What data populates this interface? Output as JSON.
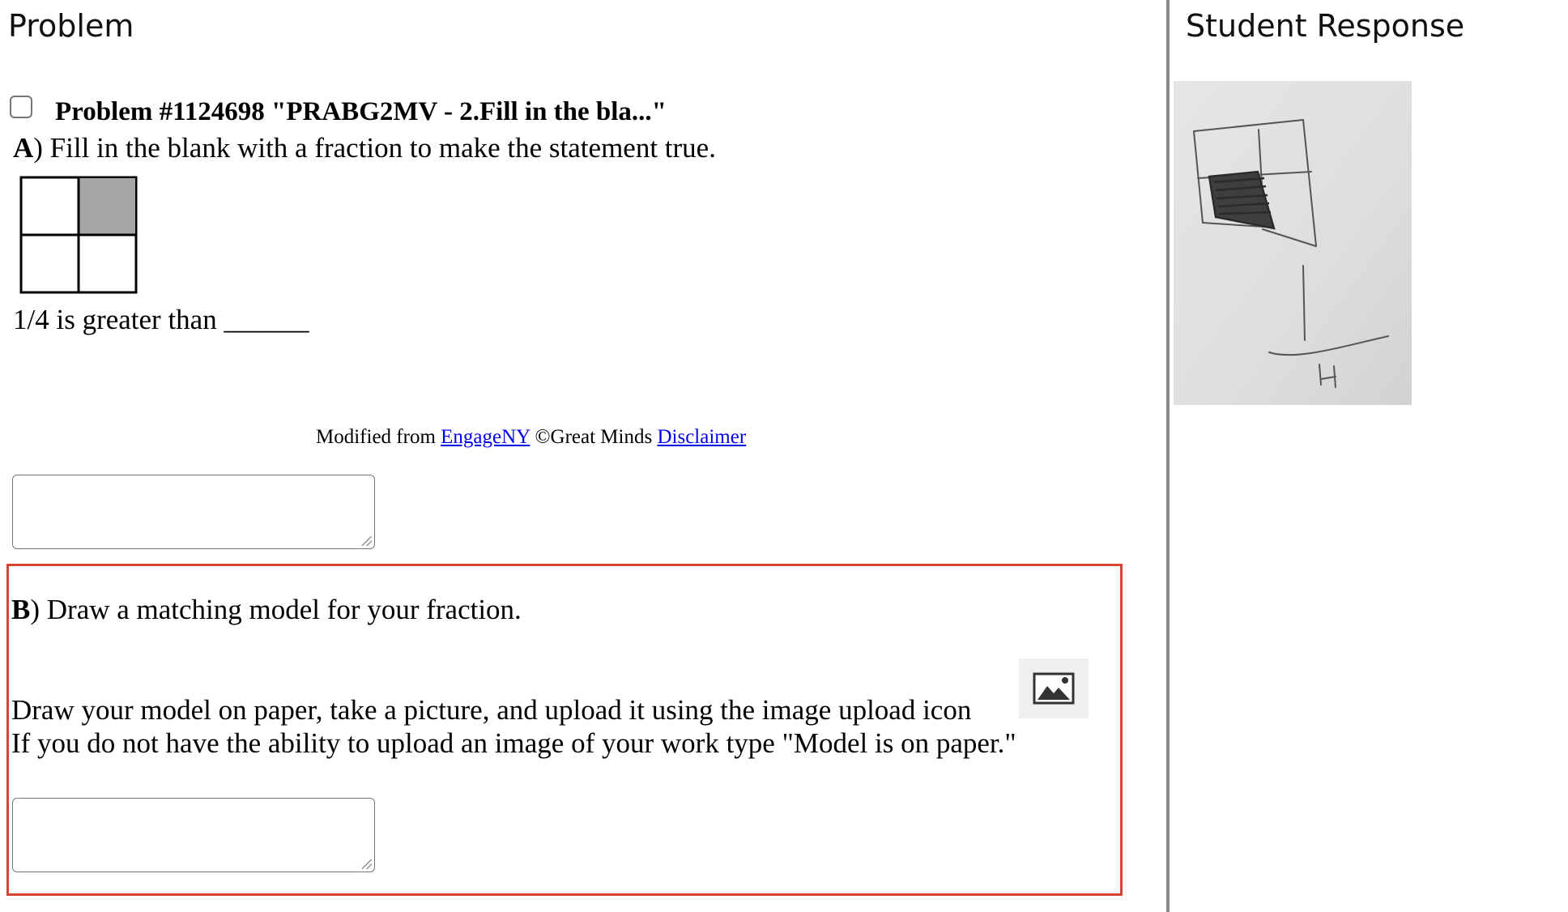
{
  "problem_panel": {
    "title": "Problem",
    "problem_title": "Problem #1124698 \"PRABG2MV - 2.Fill in the bla...\"",
    "part_a": {
      "label": "A",
      "prompt": ") Fill in the blank with a fraction to make the statement true.",
      "statement": "1/4 is greater than ______",
      "fraction_model": {
        "total_parts": 4,
        "shaded_parts": 1,
        "shaded_color": "#a6a6a6"
      },
      "answer_value": ""
    },
    "attribution": {
      "prefix": "Modified from",
      "link1": "EngageNY",
      "middle": "©Great Minds",
      "link2": "Disclaimer"
    },
    "part_b": {
      "label": "B",
      "prompt": ") Draw a matching model for your fraction.",
      "instruction_line1": "Draw your model on paper, take a picture, and upload it using the image upload icon",
      "instruction_line2": "If you do not have the ability to upload an image of your work type \"Model is on paper.\"",
      "upload_icon": "image-upload-icon",
      "highlight_color": "#d9442f",
      "answer_value": ""
    }
  },
  "student_panel": {
    "title": "Student Response",
    "photo_icon": "student-drawing-photo"
  }
}
